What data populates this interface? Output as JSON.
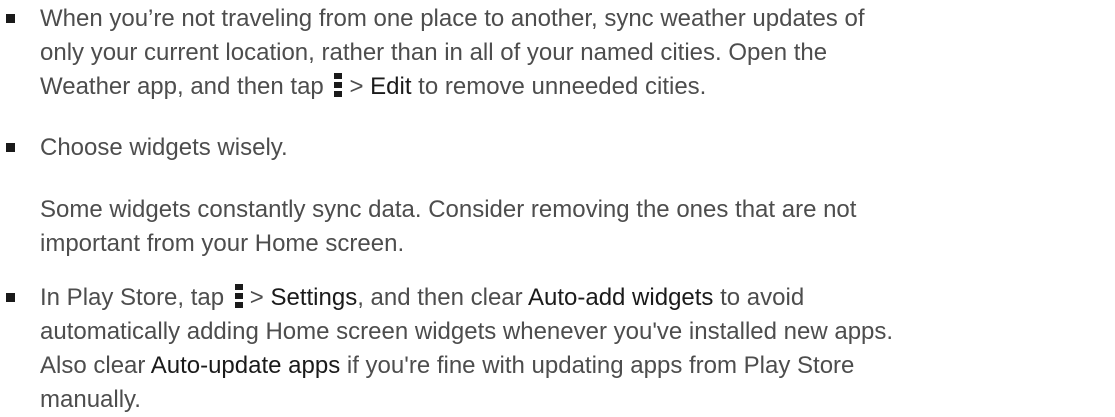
{
  "items": [
    {
      "l1": "When you’re not traveling from one place to another, sync weather updates of",
      "l2": "only your current location, rather than in all of your named cities. Open the",
      "l3a": "Weather app, and then tap",
      "l3b": ">",
      "l3c": "Edit",
      "l3d": "to remove unneeded cities."
    },
    {
      "l1": "Choose widgets wisely.",
      "p1": "Some widgets constantly sync data. Consider removing the ones that are not",
      "p2": "important from your Home screen."
    },
    {
      "l1a": "In Play Store, tap",
      "l1b": ">",
      "l1c": "Settings",
      "l1d": ", and then clear",
      "l1e": "Auto-add widgets",
      "l1f": "to avoid",
      "l2": "automatically adding Home screen widgets whenever you've installed new apps.",
      "l3a": "Also clear",
      "l3b": "Auto-update apps",
      "l3c": "if you're fine with updating apps from Play Store",
      "l4": "manually."
    }
  ],
  "icons": [
    "menu-icon",
    "menu-icon"
  ]
}
